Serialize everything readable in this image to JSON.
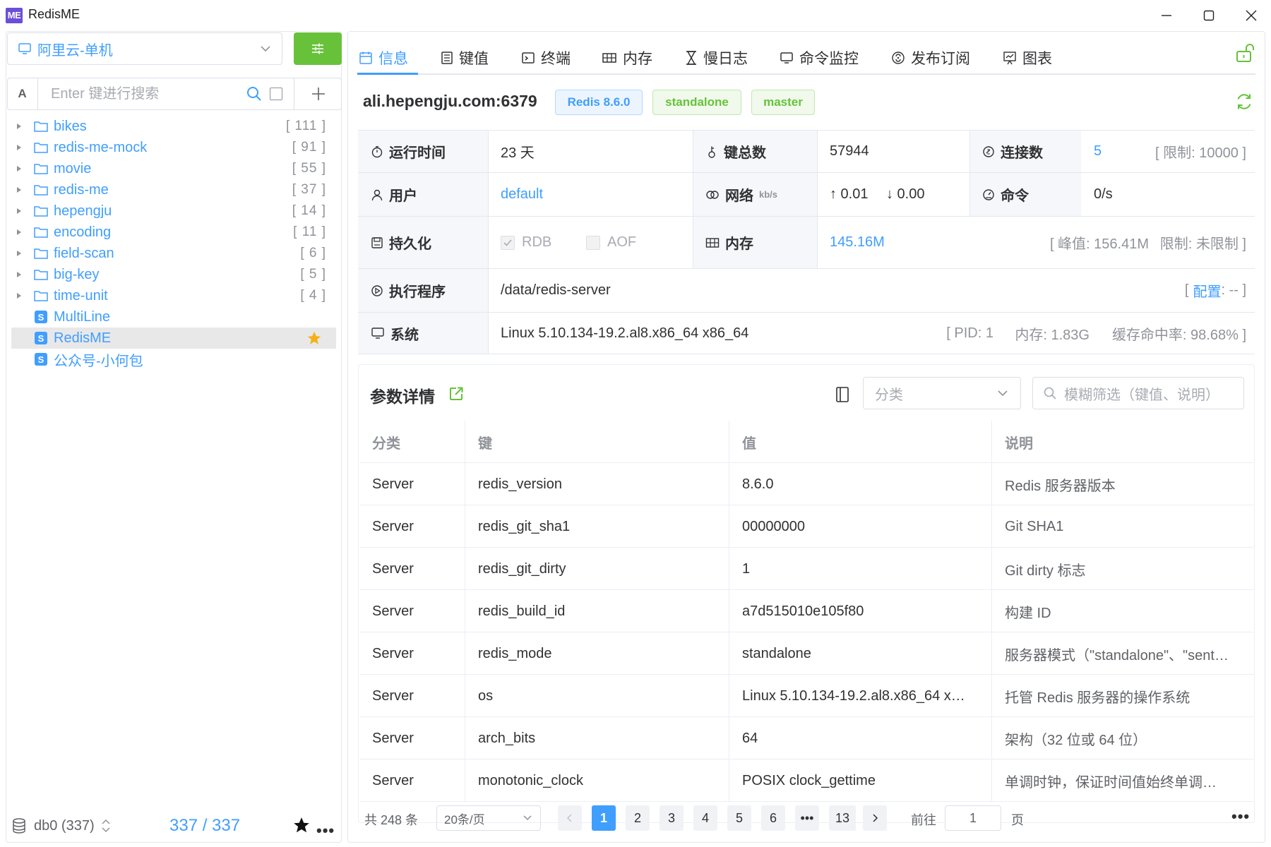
{
  "app": {
    "logo_text": "ME",
    "title": "RedisME"
  },
  "connection": {
    "label": "阿里云-单机"
  },
  "search": {
    "mode_label": "A",
    "placeholder": "Enter 键进行搜索"
  },
  "tree": [
    {
      "name": "bikes",
      "count": "[ 111 ]",
      "type": "folder"
    },
    {
      "name": "redis-me-mock",
      "count": "[ 91 ]",
      "type": "folder"
    },
    {
      "name": "movie",
      "count": "[ 55 ]",
      "type": "folder"
    },
    {
      "name": "redis-me",
      "count": "[ 37 ]",
      "type": "folder"
    },
    {
      "name": "hepengju",
      "count": "[ 14 ]",
      "type": "folder"
    },
    {
      "name": "encoding",
      "count": "[ 11 ]",
      "type": "folder"
    },
    {
      "name": "field-scan",
      "count": "[ 6 ]",
      "type": "folder"
    },
    {
      "name": "big-key",
      "count": "[ 5 ]",
      "type": "folder"
    },
    {
      "name": "time-unit",
      "count": "[ 4 ]",
      "type": "folder"
    },
    {
      "name": "MultiLine",
      "count": "",
      "type": "string",
      "badge": "S"
    },
    {
      "name": "RedisME",
      "count": "",
      "type": "string",
      "badge": "S",
      "selected": true,
      "starred": true
    },
    {
      "name": "公众号-小何包",
      "count": "",
      "type": "string",
      "badge": "S"
    }
  ],
  "footer": {
    "db": "db0 (337)",
    "counter": "337 / 337"
  },
  "tabs": [
    "信息",
    "键值",
    "终端",
    "内存",
    "慢日志",
    "命令监控",
    "发布订阅",
    "图表"
  ],
  "server": {
    "host": "ali.hepengju.com:6379",
    "tags": [
      "Redis 8.6.0",
      "standalone",
      "master"
    ]
  },
  "info": {
    "uptime_label": "运行时间",
    "uptime": "23 天",
    "keys_label": "键总数",
    "keys": "57944",
    "conn_label": "连接数",
    "conn": "5",
    "conn_limit": "[ 限制: 10000 ]",
    "user_label": "用户",
    "user": "default",
    "net_label": "网络",
    "net_unit": "kb/s",
    "net_up": "↑ 0.01",
    "net_down": "↓ 0.00",
    "cmd_label": "命令",
    "cmd": "0/s",
    "persist_label": "持久化",
    "rdb": "RDB",
    "aof": "AOF",
    "mem_label": "内存",
    "mem": "145.16M",
    "mem_peak": "[ 峰值: 156.41M",
    "mem_limit": "限制: 未限制 ]",
    "exec_label": "执行程序",
    "exec": "/data/redis-server",
    "config_open": "[",
    "config_link": "配置",
    "config_rest": ": -- ]",
    "sys_label": "系统",
    "sys": "Linux 5.10.134-19.2.al8.x86_64 x86_64",
    "pid": "[ PID: 1",
    "sys_mem": "内存: 1.83G",
    "hit_rate": "缓存命中率: 98.68% ]"
  },
  "params": {
    "title": "参数详情",
    "category_placeholder": "分类",
    "filter_placeholder": "模糊筛选（键值、说明）",
    "headers": [
      "分类",
      "键",
      "值",
      "说明"
    ],
    "rows": [
      [
        "Server",
        "redis_version",
        "8.6.0",
        "Redis 服务器版本"
      ],
      [
        "Server",
        "redis_git_sha1",
        "00000000",
        "Git SHA1"
      ],
      [
        "Server",
        "redis_git_dirty",
        "1",
        "Git dirty 标志"
      ],
      [
        "Server",
        "redis_build_id",
        "a7d515010e105f80",
        "构建 ID"
      ],
      [
        "Server",
        "redis_mode",
        "standalone",
        "服务器模式（\"standalone\"、\"sent…"
      ],
      [
        "Server",
        "os",
        "Linux 5.10.134-19.2.al8.x86_64 x…",
        "托管 Redis 服务器的操作系统"
      ],
      [
        "Server",
        "arch_bits",
        "64",
        "架构（32 位或 64 位）"
      ],
      [
        "Server",
        "monotonic_clock",
        "POSIX clock_gettime",
        "单调时钟，保证时间值始终单调…"
      ]
    ]
  },
  "pagination": {
    "total": "共 248 条",
    "page_size": "20条/页",
    "pages": [
      "1",
      "2",
      "3",
      "4",
      "5",
      "6",
      "•••",
      "13"
    ],
    "current": "1",
    "goto_label": "前往",
    "goto_value": "1",
    "goto_unit": "页",
    "more": "•••"
  }
}
